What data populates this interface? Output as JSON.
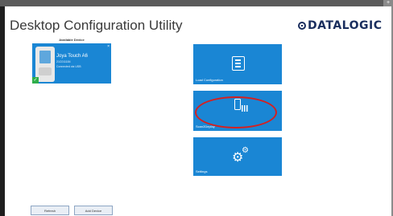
{
  "window": {
    "control": "+"
  },
  "header": {
    "title": "Desktop Configuration Utility",
    "brand": "DATALOGIC"
  },
  "devices": {
    "section_label": "Available Device",
    "items": [
      {
        "name": "Joya Touch A6",
        "serial": "21C011184",
        "connection": "Connected via USB",
        "close": "×",
        "selected_mark": "✓"
      }
    ]
  },
  "tiles": [
    {
      "label": "Load Configuration",
      "icon": "document-list-icon"
    },
    {
      "label": "Scan2Deploy",
      "icon": "phone-barcode-icon"
    },
    {
      "label": "Settings",
      "icon": "gears-icon"
    }
  ],
  "footer": {
    "refresh_label": "Refresh",
    "add_device_label": "Add Device"
  },
  "colors": {
    "accent": "#1a86d4",
    "highlight": "#d42020",
    "brand": "#1a2e5e"
  }
}
